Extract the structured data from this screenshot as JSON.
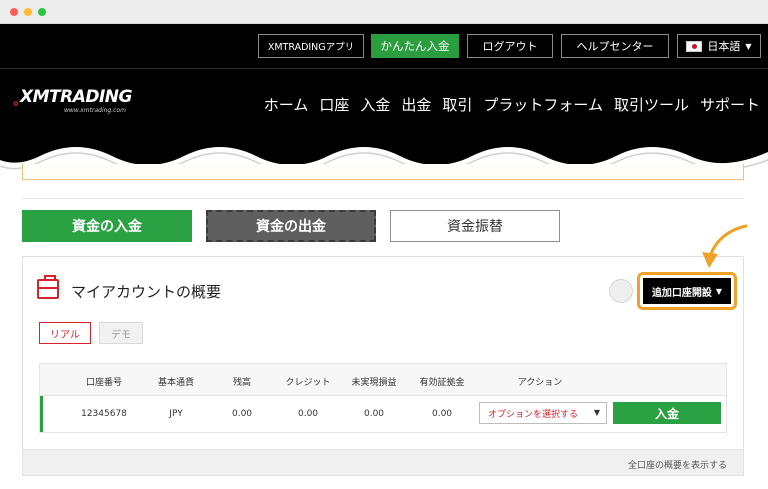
{
  "header": {
    "top_buttons": {
      "apps": "XMTRADINGアプリ",
      "easy_deposit": "かんたん入金",
      "logout": "ログアウト",
      "help_center": "ヘルプセンター",
      "language": "日本語"
    },
    "logo": {
      "brand": "XMTRADING",
      "url": "www.xmtrading.com"
    },
    "nav": [
      "ホーム",
      "口座",
      "入金",
      "出金",
      "取引",
      "プラットフォーム",
      "取引ツール",
      "サポート"
    ]
  },
  "tabs": {
    "deposit": "資金の入金",
    "withdraw": "資金の出金",
    "transfer": "資金振替"
  },
  "panel": {
    "title": "マイアカウントの概要",
    "add_account": "追加口座開設",
    "account_types": {
      "real": "リアル",
      "demo": "デモ"
    },
    "table": {
      "headers": [
        "口座番号",
        "基本通貨",
        "残高",
        "クレジット",
        "未実現損益",
        "有効証拠金",
        "アクション"
      ],
      "row": {
        "account_no": "12345678",
        "currency": "JPY",
        "balance": "0.00",
        "credit": "0.00",
        "unrealized": "0.00",
        "equity": "0.00",
        "action_select": "オプションを選択する",
        "deposit_button": "入金"
      }
    },
    "show_all": "全口座の概要を表示する"
  },
  "colors": {
    "brand_red": "#d8232a",
    "green": "#2aa142",
    "highlight_orange": "#f0a126",
    "header_black": "#000000"
  }
}
